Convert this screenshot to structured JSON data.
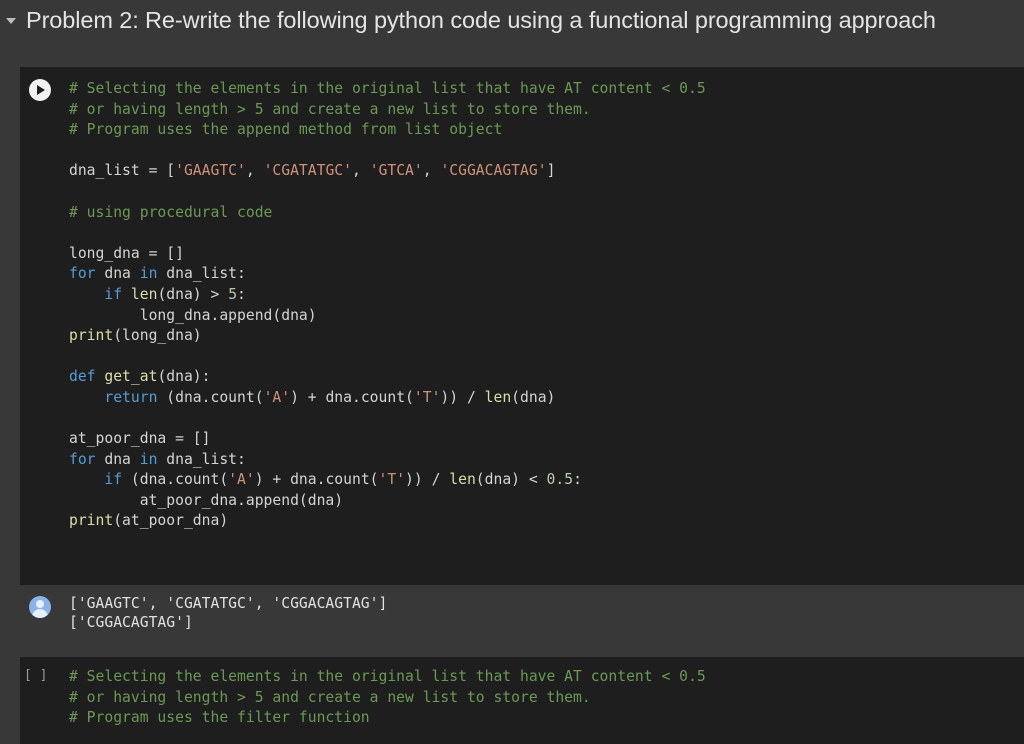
{
  "section": {
    "title": "Problem 2: Re-write the following python code using a functional programming approach"
  },
  "cell1": {
    "code": [
      "# Selecting the elements in the original list that have AT content < 0.5",
      "# or having length > 5 and create a new list to store them.",
      "# Program uses the append method from list object",
      "",
      "dna_list = ['GAAGTC', 'CGATATGC', 'GTCA', 'CGGACAGTAG']",
      "",
      "# using procedural code",
      "",
      "long_dna = []",
      "for dna in dna_list:",
      "    if len(dna) > 5:",
      "        long_dna.append(dna)",
      "print(long_dna)",
      "",
      "def get_at(dna):",
      "    return (dna.count('A') + dna.count('T')) / len(dna)",
      "",
      "at_poor_dna = []",
      "for dna in dna_list:",
      "    if (dna.count('A') + dna.count('T')) / len(dna) < 0.5:",
      "        at_poor_dna.append(dna)",
      "print(at_poor_dna)"
    ],
    "output": [
      "['GAAGTC', 'CGATATGC', 'CGGACAGTAG']",
      "['CGGACAGTAG']"
    ]
  },
  "cell2": {
    "execution_count": "[ ]",
    "code": [
      "# Selecting the elements in the original list that have AT content < 0.5",
      "# or having length > 5 and create a new list to store them.",
      "# Program uses the filter function"
    ]
  },
  "icons": {
    "run": "play-icon",
    "output": "avatar-icon",
    "collapse": "caret-down-icon"
  },
  "colors": {
    "code_background": "#1e1e1e",
    "page_background": "#383838",
    "comment": "#6a9955",
    "keyword": "#569cd6",
    "string": "#ce9178",
    "number": "#b5cea8",
    "function": "#dcdcaa"
  }
}
